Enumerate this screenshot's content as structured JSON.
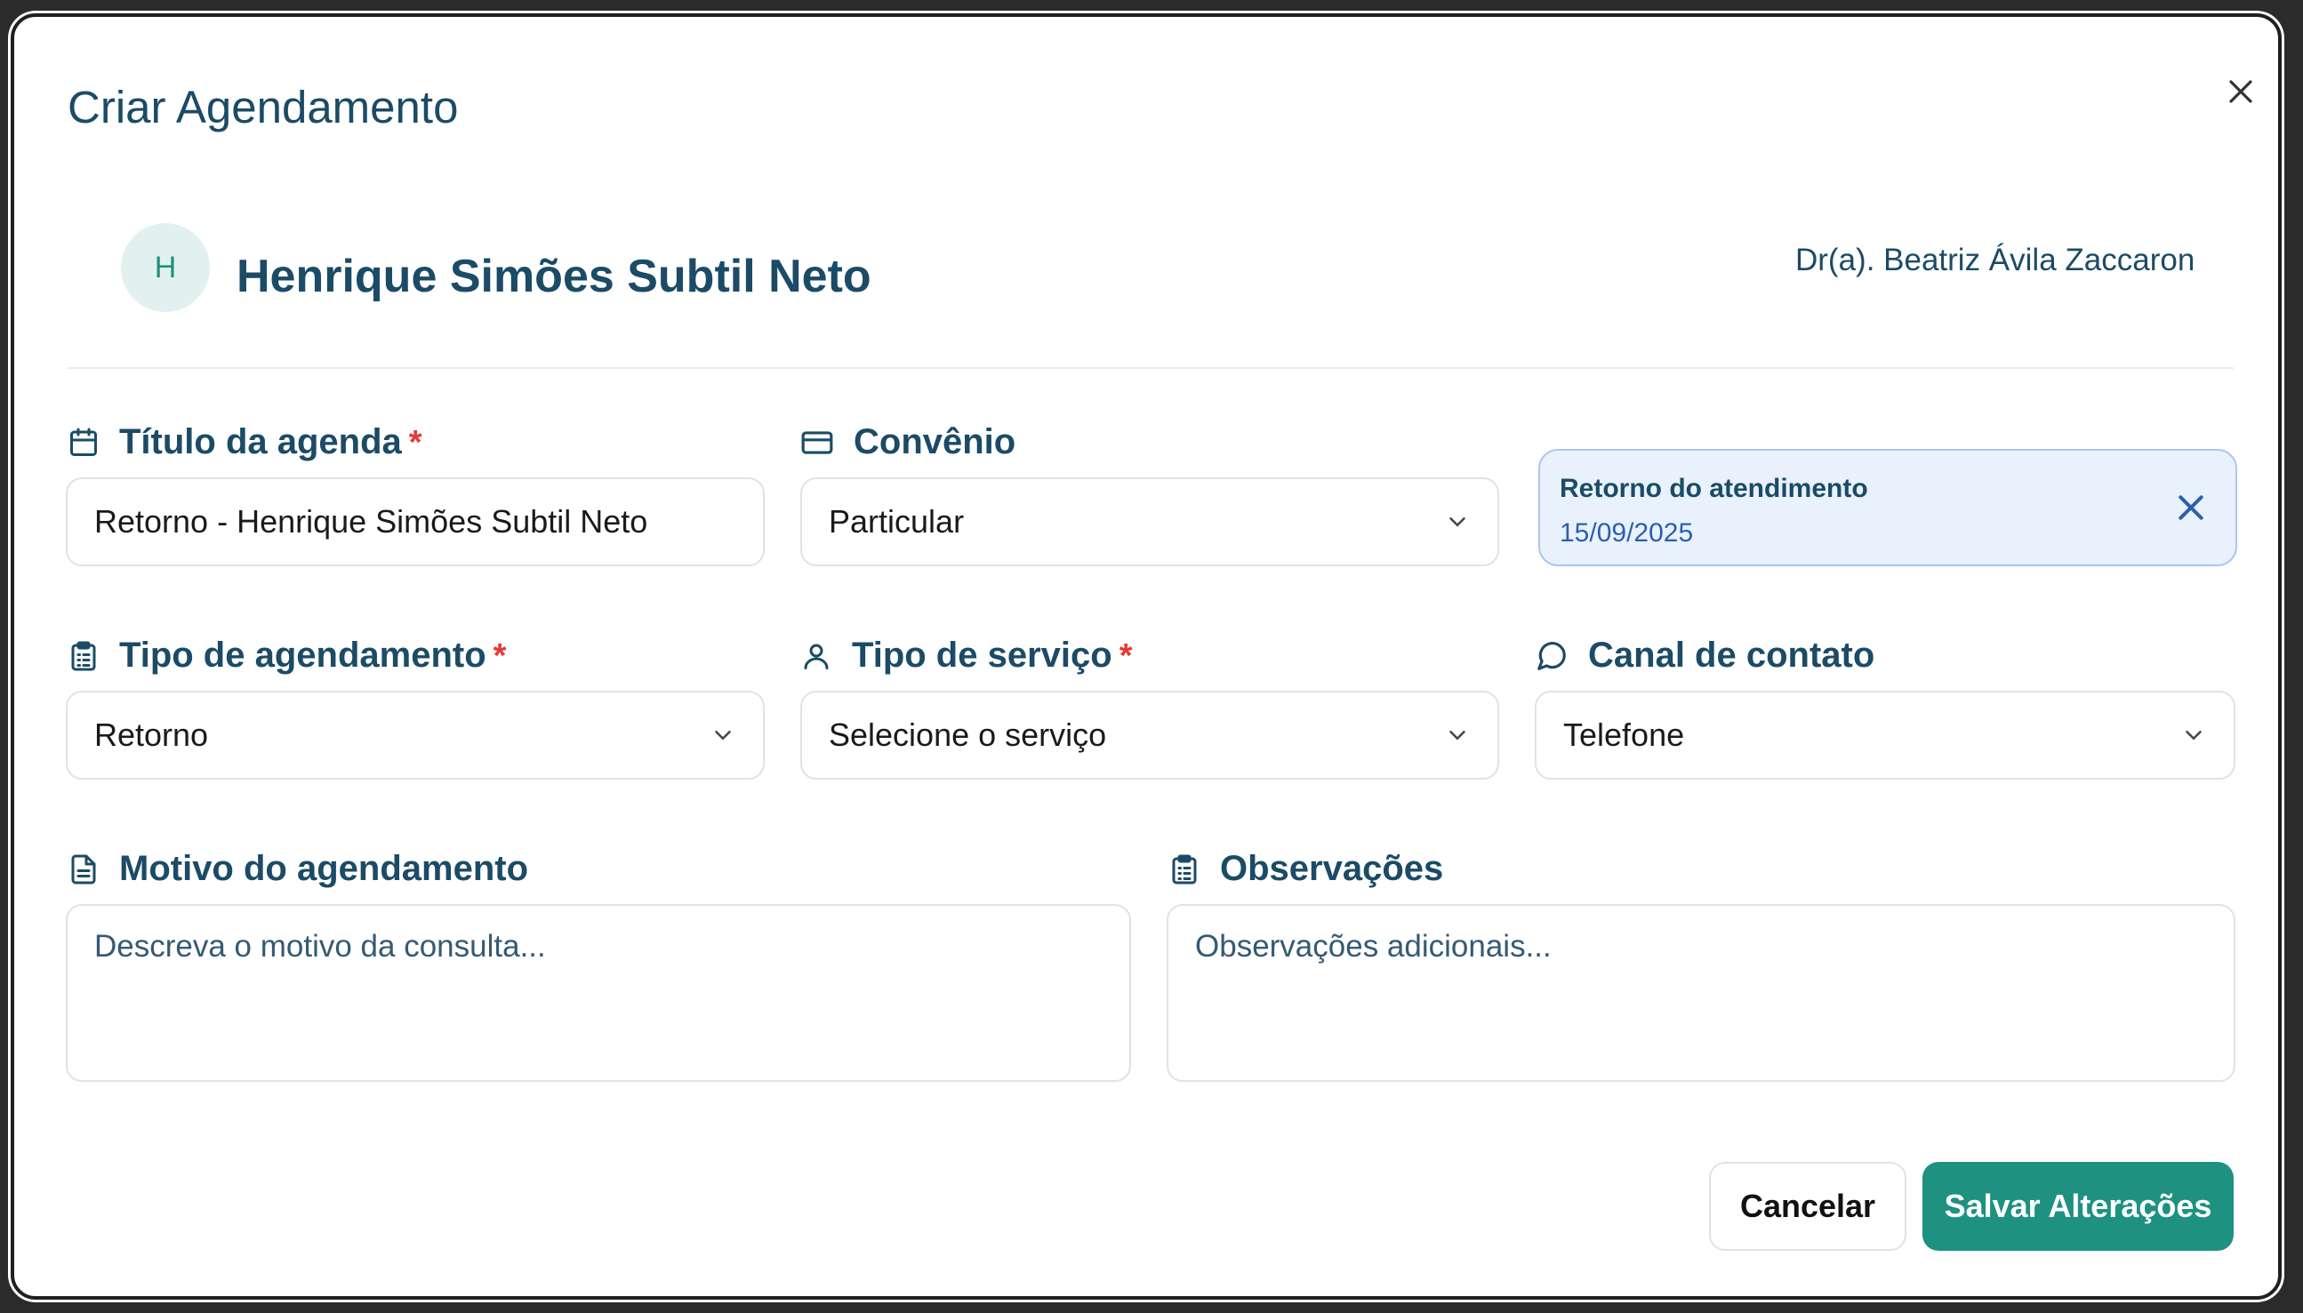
{
  "dialog": {
    "title": "Criar Agendamento"
  },
  "patient": {
    "initial": "H",
    "name": "Henrique Simões Subtil Neto"
  },
  "doctor": {
    "name": "Dr(a). Beatriz Ávila Zaccaron"
  },
  "fields": {
    "titulo": {
      "label": "Título da agenda",
      "required": "*",
      "value": "Retorno - Henrique Simões Subtil Neto"
    },
    "convenio": {
      "label": "Convênio",
      "value": "Particular"
    },
    "tipo_agendamento": {
      "label": "Tipo de agendamento",
      "required": "*",
      "value": "Retorno"
    },
    "tipo_servico": {
      "label": "Tipo de serviço",
      "required": "*",
      "value": "Selecione o serviço"
    },
    "canal_contato": {
      "label": "Canal de contato",
      "value": "Telefone"
    },
    "motivo": {
      "label": "Motivo do agendamento",
      "placeholder": "Descreva o motivo da consulta..."
    },
    "observacoes": {
      "label": "Observações",
      "placeholder": "Observações adicionais..."
    }
  },
  "retorno": {
    "title": "Retorno do atendimento",
    "date": "15/09/2025"
  },
  "buttons": {
    "cancel": "Cancelar",
    "save": "Salvar Alterações"
  },
  "colors": {
    "primary": "#1e9181",
    "text": "#1b4b66",
    "required": "#e53935",
    "info_bg": "#e9f1fc",
    "info_border": "#a9c6ef"
  },
  "icons": [
    "close-icon",
    "calendar-icon",
    "credit-card-icon",
    "clipboard-list-icon",
    "user-icon",
    "message-circle-icon",
    "file-text-icon",
    "chevron-down-icon"
  ]
}
